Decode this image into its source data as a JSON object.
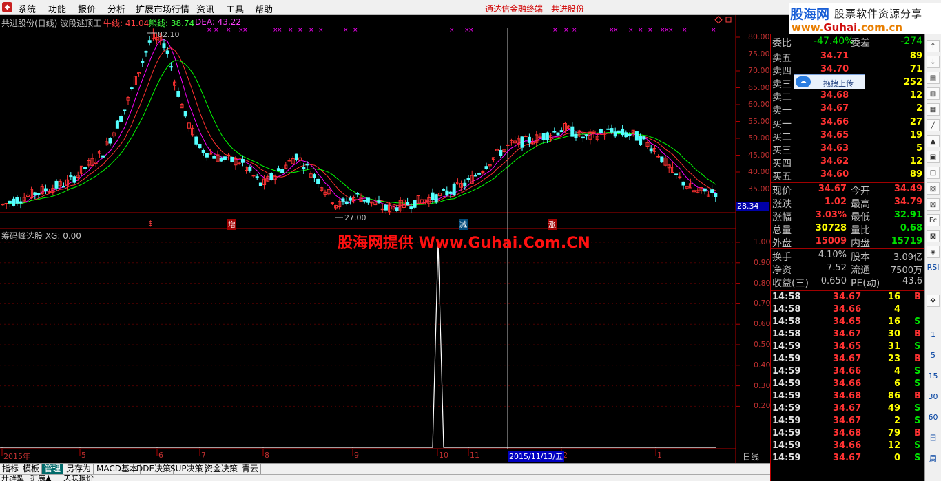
{
  "menu": {
    "items": [
      "系统",
      "功能",
      "报价",
      "分析",
      "扩展市场行情",
      "资讯",
      "工具",
      "帮助"
    ],
    "center_title": "通达信金融终端",
    "stock_title": "共进股份"
  },
  "logo": {
    "site": "股海网",
    "slogan": "股票软件资源分享",
    "domain_prefix": "www.",
    "domain_brand": "Guhai",
    "domain_suffix": ".com.cn"
  },
  "main_chart": {
    "stock_label": "共进股份(日线) 波段逃顶王",
    "ind1_label": "牛线: 41.04",
    "ind2_label": "熊线: 38.74",
    "ind3_label": "DEA: 43.22",
    "price_axis": [
      "80.00",
      "75.00",
      "70.00",
      "65.00",
      "60.00",
      "55.00",
      "50.00",
      "45.00",
      "40.00",
      "35.00"
    ],
    "current_price_tag": "28.34",
    "high_label": "82.10",
    "low_label": "27.00",
    "signals": [
      "$",
      "增",
      "减",
      "涨"
    ],
    "sub_label": "筹码峰选股 XG: 0.00",
    "sub_axis": [
      "1.00",
      "0.90",
      "0.80",
      "0.70",
      "0.60",
      "0.50",
      "0.40",
      "0.30",
      "0.20"
    ],
    "watermark": "股海网提供 Www.Guhai.Com.CN",
    "date_axis": [
      "2015年",
      "5",
      "6",
      "7",
      "8",
      "9",
      "10",
      "11",
      "2",
      "1"
    ],
    "cursor_date": "2015/11/13/五",
    "period": "日线",
    "series_colors": {
      "up": "#ff3232",
      "down": "#54ffff",
      "ma1": "#ff00ff",
      "ma2": "#ff3030",
      "ma3": "#00ff00",
      "xg": "#ffffff"
    }
  },
  "chart_data": {
    "type": "line",
    "title": "",
    "xlabel": "",
    "ylabel": "",
    "ylim": [
      0,
      1
    ],
    "x": [
      "2015年",
      "5",
      "6",
      "7",
      "8",
      "9",
      "10",
      "11",
      "2",
      "1"
    ],
    "series": [
      {
        "name": "XG",
        "values": [
          0,
          0,
          0,
          0,
          0,
          0,
          1,
          0,
          0,
          0
        ]
      }
    ]
  },
  "quote": {
    "weibi": {
      "label": "委比",
      "value": "-47.40%",
      "label2": "委差",
      "value2": "-274"
    },
    "sell": [
      {
        "label": "卖五",
        "price": "34.71",
        "vol": "89"
      },
      {
        "label": "卖四",
        "price": "34.70",
        "vol": "71"
      },
      {
        "label": "卖三",
        "price": "",
        "vol": "252"
      },
      {
        "label": "卖二",
        "price": "34.68",
        "vol": "12"
      },
      {
        "label": "卖一",
        "price": "34.67",
        "vol": "2"
      }
    ],
    "buy": [
      {
        "label": "买一",
        "price": "34.66",
        "vol": "27"
      },
      {
        "label": "买二",
        "price": "34.65",
        "vol": "19"
      },
      {
        "label": "买三",
        "price": "34.63",
        "vol": "5"
      },
      {
        "label": "买四",
        "price": "34.62",
        "vol": "12"
      },
      {
        "label": "买五",
        "price": "34.60",
        "vol": "89"
      }
    ],
    "stats": [
      {
        "l1": "现价",
        "v1": "34.67",
        "l2": "今开",
        "v2": "34.49",
        "c1": "#ff3232",
        "c2": "#ff3232"
      },
      {
        "l1": "涨跌",
        "v1": "1.02",
        "l2": "最高",
        "v2": "34.79",
        "c1": "#ff3232",
        "c2": "#ff3232"
      },
      {
        "l1": "涨幅",
        "v1": "3.03%",
        "l2": "最低",
        "v2": "32.91",
        "c1": "#ff3232",
        "c2": "#00e000"
      },
      {
        "l1": "总量",
        "v1": "30728",
        "l2": "量比",
        "v2": "0.68",
        "c1": "#ffff00",
        "c2": "#00e000"
      },
      {
        "l1": "外盘",
        "v1": "15009",
        "l2": "内盘",
        "v2": "15719",
        "c1": "#ff3232",
        "c2": "#00e000"
      }
    ],
    "stats2": [
      {
        "l1": "换手",
        "v1": "4.10%",
        "l2": "股本",
        "v2": "3.09亿"
      },
      {
        "l1": "净资",
        "v1": "7.52",
        "l2": "流通",
        "v2": "7500万"
      },
      {
        "l1": "收益(三)",
        "v1": "0.650",
        "l2": "PE(动)",
        "v2": "43.6"
      }
    ],
    "ticks": [
      {
        "time": "14:58",
        "price": "34.67",
        "vol": "16",
        "side": "B"
      },
      {
        "time": "14:58",
        "price": "34.66",
        "vol": "4",
        "side": ""
      },
      {
        "time": "14:58",
        "price": "34.65",
        "vol": "16",
        "side": "S"
      },
      {
        "time": "14:58",
        "price": "34.67",
        "vol": "30",
        "side": "B"
      },
      {
        "time": "14:59",
        "price": "34.65",
        "vol": "31",
        "side": "S"
      },
      {
        "time": "14:59",
        "price": "34.67",
        "vol": "23",
        "side": "B"
      },
      {
        "time": "14:59",
        "price": "34.66",
        "vol": "4",
        "side": "S"
      },
      {
        "time": "14:59",
        "price": "34.66",
        "vol": "6",
        "side": "S"
      },
      {
        "time": "14:59",
        "price": "34.68",
        "vol": "86",
        "side": "B"
      },
      {
        "time": "14:59",
        "price": "34.67",
        "vol": "49",
        "side": "S"
      },
      {
        "time": "14:59",
        "price": "34.67",
        "vol": "2",
        "side": "S"
      },
      {
        "time": "14:59",
        "price": "34.68",
        "vol": "79",
        "side": "B"
      },
      {
        "time": "14:59",
        "price": "34.66",
        "vol": "12",
        "side": "S"
      },
      {
        "time": "14:59",
        "price": "34.67",
        "vol": "0",
        "side": "S"
      }
    ]
  },
  "popup": {
    "upload_label": "拖拽上传"
  },
  "tabs": [
    "指标",
    "模板",
    "管理",
    "另存为",
    "MACD基本",
    "DDE决策",
    "SUP决策",
    "资金决策",
    "青云"
  ],
  "subtabs": [
    "开辟型",
    "扩展▲",
    "关联报价"
  ],
  "side_tools": [
    "RSI",
    "1",
    "5",
    "15",
    "30",
    "60",
    "日",
    "周"
  ]
}
